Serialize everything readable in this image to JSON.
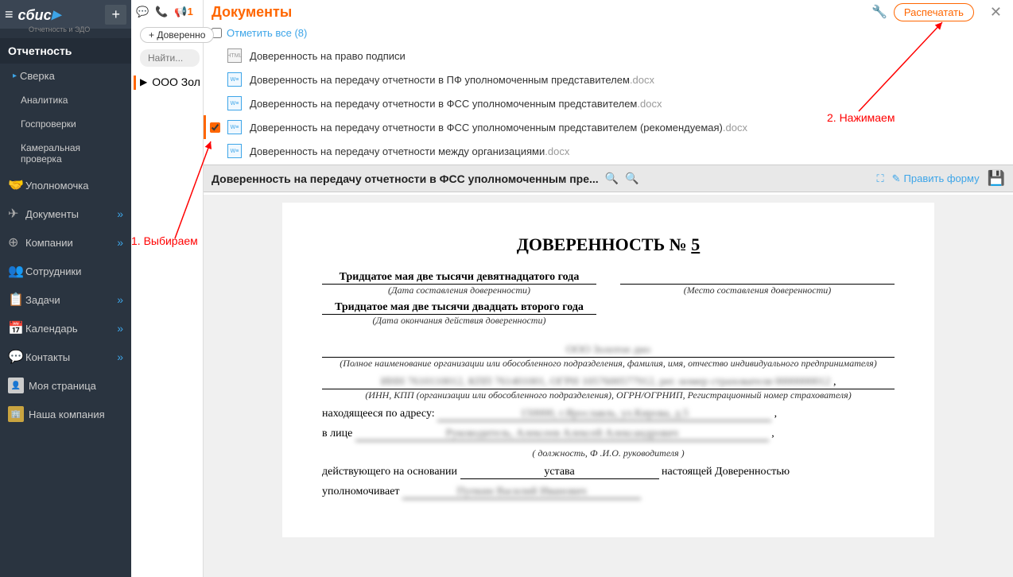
{
  "sidebar": {
    "logo": "сбис",
    "logo_sub": "Отчетность и ЭДО",
    "section": "Отчетность",
    "items": [
      {
        "label": "Сверка",
        "sub": false,
        "expanded": true
      },
      {
        "label": "Аналитика",
        "sub": true
      },
      {
        "label": "Госпроверки",
        "sub": true
      },
      {
        "label": "Камеральная проверка",
        "sub": true
      }
    ],
    "main_items": [
      {
        "label": "Уполномочка",
        "icon": "🤝"
      },
      {
        "label": "Документы",
        "icon": "✈",
        "chevron": true
      },
      {
        "label": "Компании",
        "icon": "⊕",
        "chevron": true
      },
      {
        "label": "Сотрудники",
        "icon": "👥"
      },
      {
        "label": "Задачи",
        "icon": "📋",
        "chevron": true
      },
      {
        "label": "Календарь",
        "icon": "📅",
        "chevron": true
      },
      {
        "label": "Контакты",
        "icon": "💬",
        "chevron": true
      },
      {
        "label": "Моя страница",
        "icon": "",
        "avatar": true
      },
      {
        "label": "Наша компания",
        "icon": "",
        "avatar": true,
        "gold": true
      }
    ]
  },
  "topbar": {
    "notif_count": "1"
  },
  "middle": {
    "add_btn": "+ Доверенно",
    "search_placeholder": "Найти...",
    "org": "ООО Зол"
  },
  "panel": {
    "title": "Документы",
    "print_btn": "Распечатать",
    "mark_all": "Отметить все (8)",
    "docs": [
      {
        "name": "Доверенность на право подписи",
        "ext": "",
        "icon": "html",
        "checked": false
      },
      {
        "name": "Доверенность на передачу отчетности в ПФ уполномоченным представителем",
        "ext": ".docx",
        "icon": "word",
        "checked": false
      },
      {
        "name": "Доверенность на передачу отчетности в ФСС уполномоченным представителем",
        "ext": ".docx",
        "icon": "word",
        "checked": false
      },
      {
        "name": "Доверенность на передачу отчетности в ФСС уполномоченным представителем (рекомендуемая)",
        "ext": ".docx",
        "icon": "word",
        "checked": true
      },
      {
        "name": "Доверенность на передачу отчетности между организациями",
        "ext": ".docx",
        "icon": "word",
        "checked": false
      }
    ],
    "preview_title": "Доверенность на передачу отчетности в ФСС уполномоченным пре...",
    "edit_form": "Править форму"
  },
  "doc": {
    "title": "ДОВЕРЕННОСТЬ № ",
    "num": "5",
    "date_written": "Тридцатое мая две тысячи девятнадцатого года",
    "date_hint": "(Дата составления доверенности)",
    "place_hint": "(Место составления доверенности)",
    "date_end": "Тридцатое мая две тысячи двадцать второго года",
    "date_end_hint": "(Дата окончания действия доверенности)",
    "org_blur": "ООО Золотое дно",
    "org_hint": "(Полное наименование организации или обособленного подразделения, фамилия, имя, отчество индивидуального предпринимателя)",
    "inn_blur": "ИНН 7610110012, КПП 761401001, ОГРН 1057600577912, рег. номер страхователя 0000000012",
    "inn_hint": "(ИНН, КПП (организации или обособленного подразделения), ОГРН/ОГРНИП, Регистрационный номер страхователя)",
    "addr_label": "находящееся по адресу:",
    "addr_blur": "150000, г.Ярославль, ул.Кирова, д.5",
    "person_label": "в лице",
    "person_blur": "Руководитель, Алексеев Алексей Александрович",
    "person_hint": "( должность, Ф .И.О. руководителя )",
    "acting_label": "действующего на основании",
    "acting_val": "устава",
    "acting_suffix": "настоящей Доверенностью",
    "auth_label": "уполномочивает",
    "auth_blur": "Пупкин Василий Иванович"
  },
  "annotations": {
    "text1": "1. Выбираем",
    "text2": "2. Нажимаем"
  }
}
